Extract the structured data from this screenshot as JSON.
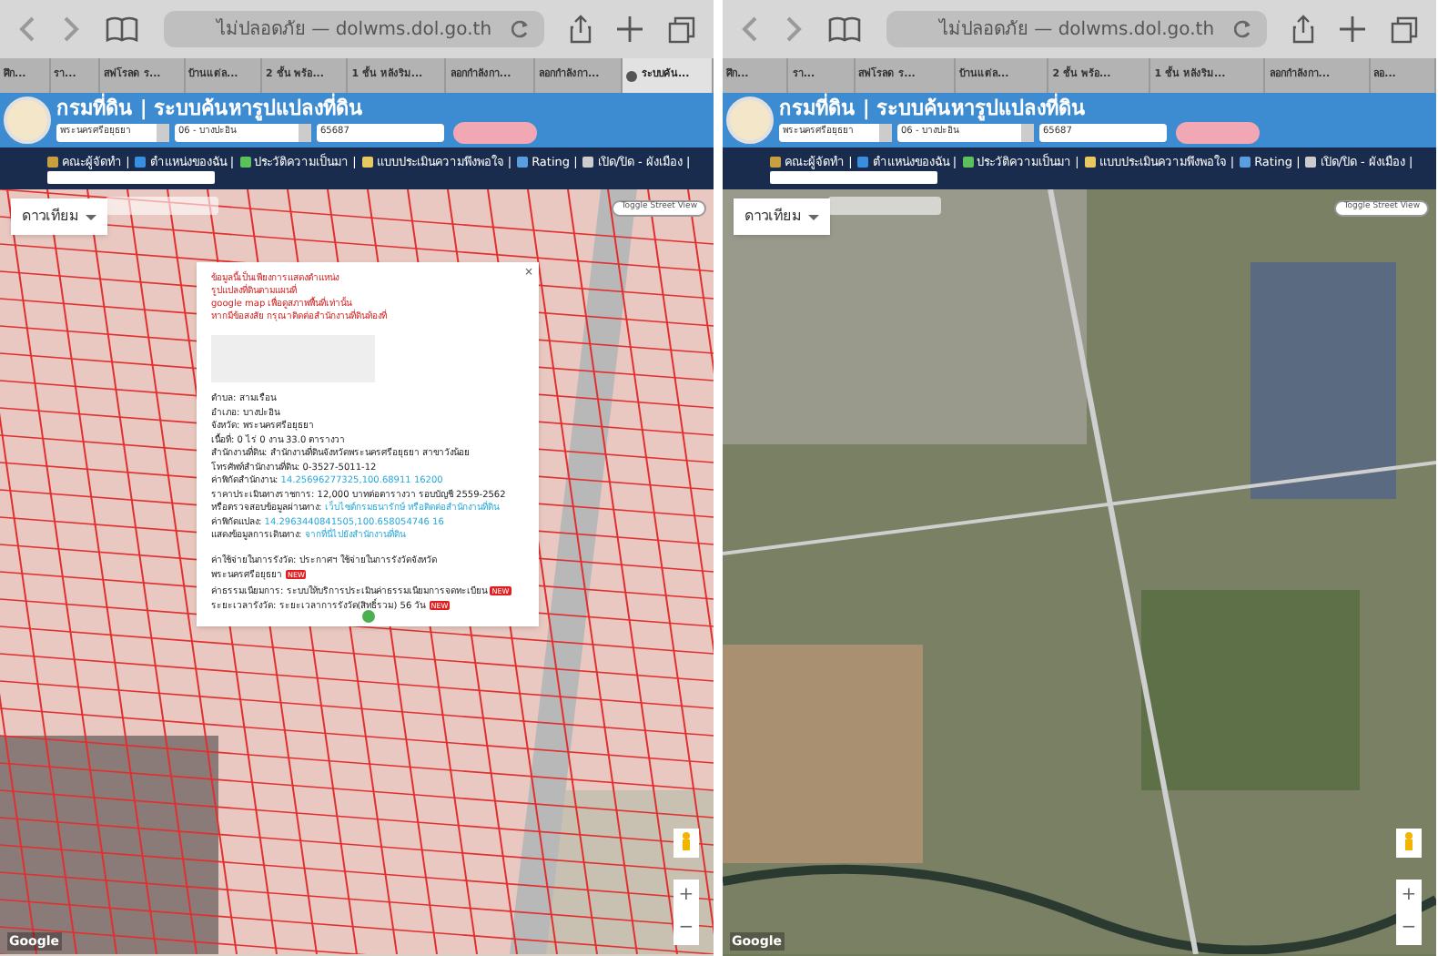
{
  "panels": [
    {
      "browser": {
        "url": "ไม่ปลอดภัย — dolwms.dol.go.th",
        "tabs": [
          {
            "label": "ศึก...",
            "selected": false
          },
          {
            "label": "รา...",
            "selected": false
          },
          {
            "label": "สฟโรลด ร...",
            "selected": false
          },
          {
            "label": "บ้านแต่ล...",
            "selected": false
          },
          {
            "label": "2 ชั้น พร้อ...",
            "selected": false
          },
          {
            "label": "1 ชั้น หลังริม...",
            "selected": false
          },
          {
            "label": "ลอกกำลังกา...",
            "selected": false
          },
          {
            "label": "ลอกกำลังกา...",
            "selected": false
          },
          {
            "label": "ระบบค้น...",
            "selected": true
          }
        ]
      },
      "header": {
        "title": "กรมที่ดิน | ระบบค้นหารูปแปลงที่ดิน",
        "province": "พระนครศรีอยุธยา",
        "district": "06 - บางปะอิน",
        "parcel_no": "65687"
      },
      "nav": {
        "items": [
          "คณะผู้จัดทำ |",
          "ตำแหน่งของฉัน |",
          "ประวัติความเป็นมา |",
          "แบบประเมินความพึงพอใจ |",
          "Rating |",
          "เปิด/ปิด - ผังเมือง |"
        ]
      },
      "map": {
        "kind": "parcels",
        "layer": "ดาวเทียม",
        "street_view": "Toggle Street View",
        "attribution": "Google",
        "zoom_in": "+",
        "zoom_out": "−",
        "popup": {
          "close": "×",
          "notice": [
            "ข้อมูลนี้เป็นเพียงการแสดงตำแหน่ง",
            "รูปแปลงที่ดินตามแผนที่",
            "google map เพื่อดูสภาพพื้นที่เท่านั้น",
            "หากมีข้อสงสัย กรุณาติดต่อสำนักงานที่ดินท้องที่"
          ],
          "fields": [
            {
              "label": "ตำบล:",
              "value": "สามเรือน"
            },
            {
              "label": "อำเภอ:",
              "value": "บางปะอิน"
            },
            {
              "label": "จังหวัด:",
              "value": "พระนครศรีอยุธยา"
            },
            {
              "label": "เนื้อที่:",
              "value": "0 ไร่ 0 งาน 33.0 ตารางวา"
            },
            {
              "label": "สำนักงานที่ดิน:",
              "value": "สำนักงานที่ดินจังหวัดพระนครศรีอยุธยา สาขาวังน้อย"
            },
            {
              "label": "โทรศัพท์สำนักงานที่ดิน:",
              "value": "0-3527-5011-12"
            },
            {
              "label": "ค่าพิกัดสำนักงาน:",
              "value": "14.25696277325,100.68911 16200",
              "kind": "link"
            },
            {
              "label": "ราคาประเมินทางราชการ:",
              "value": "12,000 บาทต่อตารางวา รอบบัญชี 2559-2562"
            },
            {
              "label": "หรือตรวจสอบข้อมูลผ่านทาง:",
              "value": "เว็บไซต์กรมธนารักษ์ หรือติดต่อสำนักงานที่ดิน",
              "kind": "link"
            },
            {
              "label": "ค่าพิกัดแปลง:",
              "value": "14.2963440841505,100.658054746 16",
              "kind": "link"
            },
            {
              "label": "แสดงข้อมูลการเดินทาง:",
              "value": "จากที่นี่ไปยังสำนักงานที่ดิน",
              "kind": "link"
            }
          ],
          "costs": [
            {
              "label": "ค่าใช้จ่ายในการรังวัด:",
              "value": "ประกาศฯ ใช้จ่ายในการรังวัดจังหวัดพระนครศรีอยุธยา",
              "badge": "NEW"
            },
            {
              "label": "ค่าธรรมเนียมการ:",
              "value": "ระบบให้บริการประเมินค่าธรรมเนียมการจดทะเบียน",
              "badge": "NEW"
            },
            {
              "label": "ระยะเวลารังวัด:",
              "value": "ระยะเวลาการรังวัด(สิทธิ์รวม) 56 วัน",
              "badge": "NEW"
            }
          ]
        }
      }
    },
    {
      "browser": {
        "url": "ไม่ปลอดภัย — dolwms.dol.go.th",
        "tabs": [
          {
            "label": "ศึก...",
            "selected": false
          },
          {
            "label": "รา...",
            "selected": false
          },
          {
            "label": "สฟโรลด ร...",
            "selected": false
          },
          {
            "label": "บ้านแต่ล...",
            "selected": false
          },
          {
            "label": "2 ชั้น พร้อ...",
            "selected": false
          },
          {
            "label": "1 ชั้น หลังริม...",
            "selected": false
          },
          {
            "label": "ลอกกำลังกา...",
            "selected": false
          },
          {
            "label": "ลอ...",
            "selected": false
          }
        ]
      },
      "header": {
        "title": "กรมที่ดิน | ระบบค้นหารูปแปลงที่ดิน",
        "province": "พระนครศรีอยุธยา",
        "district": "06 - บางปะอิน",
        "parcel_no": "65687"
      },
      "nav": {
        "items": [
          "คณะผู้จัดทำ |",
          "ตำแหน่งของฉัน |",
          "ประวัติความเป็นมา |",
          "แบบประเมินความพึงพอใจ |",
          "Rating |",
          "เปิด/ปิด - ผังเมือง |"
        ]
      },
      "map": {
        "kind": "satellite",
        "layer": "ดาวเทียม",
        "street_view": "Toggle Street View",
        "attribution": "Google",
        "zoom_in": "+",
        "zoom_out": "−"
      }
    }
  ]
}
